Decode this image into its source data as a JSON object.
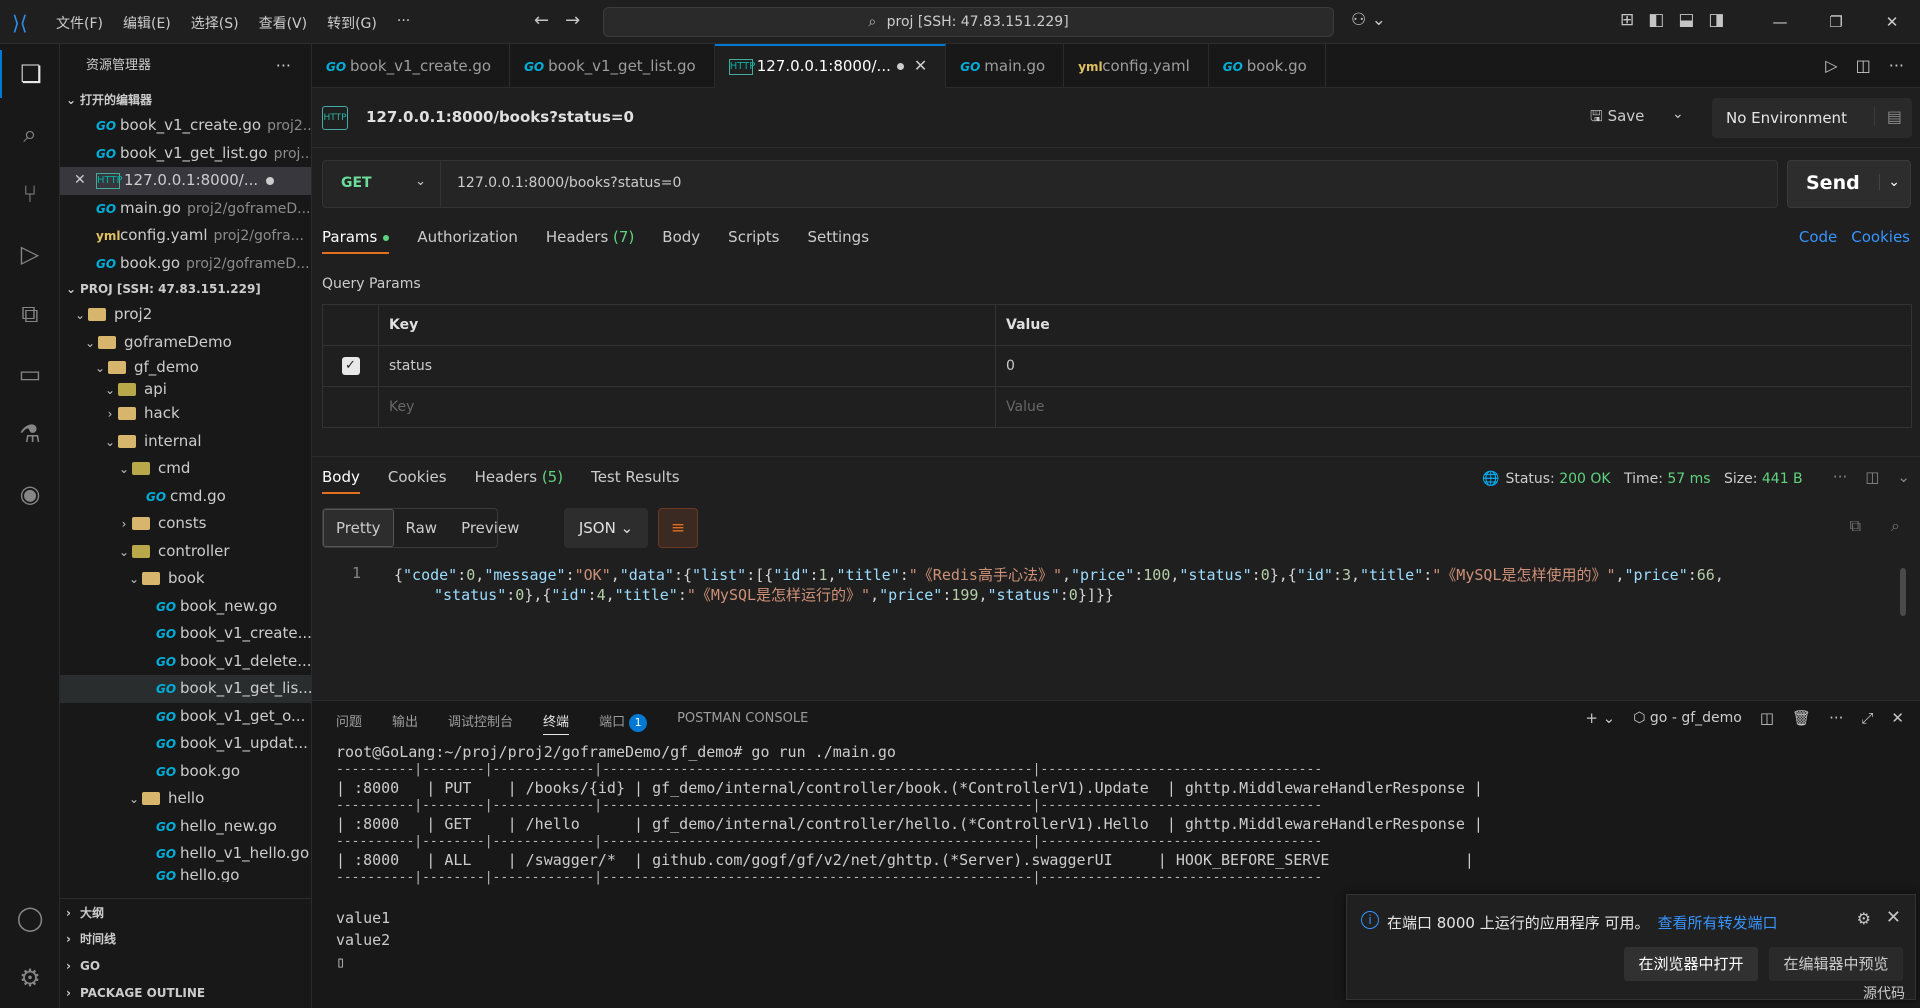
{
  "titlebar": {
    "menu": [
      "文件(F)",
      "编辑(E)",
      "选择(S)",
      "查看(V)",
      "转到(G)",
      "···"
    ],
    "search": "proj [SSH: 47.83.151.229]"
  },
  "sidebar": {
    "title": "资源管理器",
    "open_editors_label": "打开的编辑器",
    "open_editors": [
      {
        "name": "book_v1_create.go",
        "desc": "proj2..."
      },
      {
        "name": "book_v1_get_list.go",
        "desc": "proj..."
      },
      {
        "name": "127.0.0.1:8000/...",
        "desc": ""
      },
      {
        "name": "main.go",
        "desc": "proj2/goframeD..."
      },
      {
        "name": "config.yaml",
        "desc": "proj2/gofra..."
      },
      {
        "name": "book.go",
        "desc": "proj2/goframeD..."
      }
    ],
    "workspace_label": "PROJ [SSH: 47.83.151.229]",
    "tree": {
      "proj2": "proj2",
      "goframeDemo": "goframeDemo",
      "gf_demo": "gf_demo",
      "api": "api",
      "hack": "hack",
      "internal": "internal",
      "cmd": "cmd",
      "cmd_go": "cmd.go",
      "consts": "consts",
      "controller": "controller",
      "book": "book",
      "book_files": [
        "book_new.go",
        "book_v1_create...",
        "book_v1_delete...",
        "book_v1_get_lis...",
        "book_v1_get_o...",
        "book_v1_updat...",
        "book.go"
      ],
      "hello": "hello",
      "hello_files": [
        "hello_new.go",
        "hello_v1_hello.go",
        "hello.go"
      ]
    },
    "bottom_sections": [
      "大纲",
      "时间线",
      "GO",
      "PACKAGE OUTLINE"
    ]
  },
  "tabs": [
    {
      "label": "book_v1_create.go"
    },
    {
      "label": "book_v1_get_list.go"
    },
    {
      "label": "127.0.0.1:8000/..."
    },
    {
      "label": "main.go"
    },
    {
      "label": "config.yaml"
    },
    {
      "label": "book.go"
    }
  ],
  "request": {
    "badge": "HTTP",
    "title": "127.0.0.1:8000/books?status=0",
    "save_label": "Save",
    "environment": "No Environment",
    "method": "GET",
    "url": "127.0.0.1:8000/books?status=0",
    "send_label": "Send",
    "tabs": {
      "params": "Params",
      "authorization": "Authorization",
      "headers": "Headers",
      "headers_count": "(7)",
      "body": "Body",
      "scripts": "Scripts",
      "settings": "Settings"
    },
    "links": {
      "code": "Code",
      "cookies": "Cookies"
    },
    "query_params_label": "Query Params",
    "table_headers": {
      "key": "Key",
      "value": "Value"
    },
    "params": [
      {
        "key": "status",
        "value": "0",
        "checked": true
      }
    ],
    "placeholder": {
      "key": "Key",
      "value": "Value"
    }
  },
  "response": {
    "tabs": {
      "body": "Body",
      "cookies": "Cookies",
      "headers": "Headers",
      "headers_count": "(5)",
      "test_results": "Test Results"
    },
    "status_label": "Status:",
    "status_value": "200 OK",
    "time_label": "Time:",
    "time_value": "57 ms",
    "size_label": "Size:",
    "size_value": "441 B",
    "view_modes": {
      "pretty": "Pretty",
      "raw": "Raw",
      "preview": "Preview"
    },
    "format": "JSON",
    "line_number": "1"
  },
  "panel": {
    "tabs": {
      "problems": "问题",
      "output": "输出",
      "debug": "调试控制台",
      "terminal": "终端",
      "ports": "端口",
      "ports_badge": "1",
      "postman": "POSTMAN CONSOLE"
    },
    "terminal_name": "go - gf_demo",
    "lines": [
      "root@GoLang:~/proj/proj2/goframeDemo/gf_demo# go run ./main.go",
      "----------|--------|-------------|-------------------------------------------------------|------------------------------------",
      "| :8000   | PUT    | /books/{id} | gf_demo/internal/controller/book.(*ControllerV1).Update  | ghttp.MiddlewareHandlerResponse |",
      "----------|--------|-------------|-------------------------------------------------------|------------------------------------",
      "| :8000   | GET    | /hello      | gf_demo/internal/controller/hello.(*ControllerV1).Hello  | ghttp.MiddlewareHandlerResponse |",
      "----------|--------|-------------|-------------------------------------------------------|------------------------------------",
      "| :8000   | ALL    | /swagger/*  | github.com/gogf/gf/v2/net/ghttp.(*Server).swaggerUI     | HOOK_BEFORE_SERVE               |",
      "----------|--------|-------------|-------------------------------------------------------|------------------------------------",
      "",
      "value1",
      "value2"
    ]
  },
  "toast": {
    "message": "在端口 8000 上运行的应用程序 可用。",
    "link": "查看所有转发端口",
    "open_browser": "在浏览器中打开",
    "preview_editor": "在编辑器中预览",
    "source": "源代码"
  }
}
